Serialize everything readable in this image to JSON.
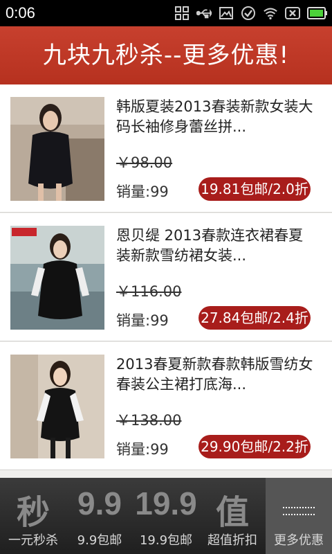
{
  "status_bar": {
    "time": "0:06",
    "icons": [
      "grid-icon",
      "usb-icon",
      "image-icon",
      "check-circle-icon",
      "wifi-icon",
      "close-box-icon",
      "battery-icon"
    ]
  },
  "header": {
    "title": "九块九秒杀--更多优惠!"
  },
  "products": [
    {
      "name_line1": "韩版夏装2013春装新款女装大",
      "name_line2": "码长袖修身蕾丝拼...",
      "original_price": "￥98.00",
      "sales": "销量:99",
      "price_label": "19.81包邮/2.0折"
    },
    {
      "name_line1": "恩贝缇 2013春款连衣裙春夏",
      "name_line2": "装新款雪纺裙女装...",
      "original_price": "￥116.00",
      "sales": "销量:99",
      "price_label": "27.84包邮/2.4折"
    },
    {
      "name_line1": "2013春夏新款春款韩版雪纺女",
      "name_line2": "春装公主裙打底海...",
      "original_price": "￥138.00",
      "sales": "销量:99",
      "price_label": "29.90包邮/2.2折"
    }
  ],
  "tabs": [
    {
      "big": "秒",
      "label": "一元秒杀"
    },
    {
      "big": "9.9",
      "label": "9.9包邮"
    },
    {
      "big": "19.9",
      "label": "19.9包邮"
    },
    {
      "big": "值",
      "label": "超值折扣"
    },
    {
      "big": "",
      "label": "更多优惠"
    }
  ],
  "colors": {
    "header": "#b93622",
    "price_button": "#a81d1b",
    "tabbar": "#2b2b2b",
    "active_tab": "#555555"
  }
}
